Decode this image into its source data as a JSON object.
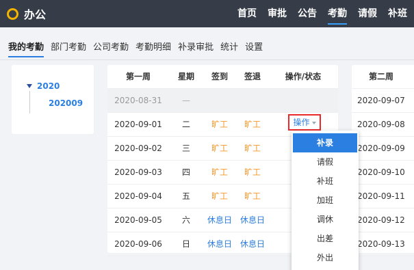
{
  "app": {
    "logo_icon": "circle-logo-icon",
    "title": "办公"
  },
  "topnav": [
    {
      "label": "首页",
      "active": false
    },
    {
      "label": "审批",
      "active": false
    },
    {
      "label": "公告",
      "active": false
    },
    {
      "label": "考勤",
      "active": true
    },
    {
      "label": "请假",
      "active": false
    },
    {
      "label": "补班",
      "active": false
    }
  ],
  "subnav": [
    {
      "label": "我的考勤",
      "active": true
    },
    {
      "label": "部门考勤",
      "active": false
    },
    {
      "label": "公司考勤",
      "active": false
    },
    {
      "label": "考勤明细",
      "active": false
    },
    {
      "label": "补录审批",
      "active": false
    },
    {
      "label": "统计",
      "active": false
    },
    {
      "label": "设置",
      "active": false
    }
  ],
  "tree": {
    "year": "2020",
    "month": "202009"
  },
  "week1": {
    "headers": {
      "week": "第一周",
      "day": "星期",
      "checkin": "签到",
      "checkout": "签退",
      "op": "操作/状态"
    },
    "rows": [
      {
        "date": "2020-08-31",
        "day": "—",
        "checkin": "",
        "checkout": "",
        "op": ""
      },
      {
        "date": "2020-09-01",
        "day": "二",
        "checkin": "旷工",
        "checkout": "旷工",
        "op": "操作"
      },
      {
        "date": "2020-09-02",
        "day": "三",
        "checkin": "旷工",
        "checkout": "旷工",
        "op": ""
      },
      {
        "date": "2020-09-03",
        "day": "四",
        "checkin": "旷工",
        "checkout": "旷工",
        "op": ""
      },
      {
        "date": "2020-09-04",
        "day": "五",
        "checkin": "旷工",
        "checkout": "旷工",
        "op": ""
      },
      {
        "date": "2020-09-05",
        "day": "六",
        "checkin": "休息日",
        "checkout": "休息日",
        "op": ""
      },
      {
        "date": "2020-09-06",
        "day": "日",
        "checkin": "休息日",
        "checkout": "休息日",
        "op": ""
      }
    ]
  },
  "week2": {
    "header": "第二周",
    "dates": [
      "2020-09-07",
      "2020-09-08",
      "2020-09-09",
      "2020-09-10",
      "2020-09-11",
      "2020-09-12",
      "2020-09-13"
    ]
  },
  "dropdown": {
    "items": [
      "补录",
      "请假",
      "补班",
      "加班",
      "调休",
      "出差",
      "外出"
    ],
    "selected": "补录"
  },
  "colors": {
    "topbar": "#363c48",
    "accent": "#2b7fe0",
    "absent": "#f5962a",
    "highlight_box": "#e82a2a",
    "logo": "#f5b400"
  }
}
